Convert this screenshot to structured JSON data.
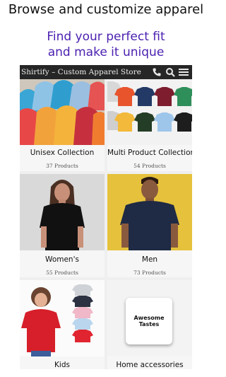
{
  "promo": {
    "heading": "Browse and customize apparel",
    "subtitle_line1": "Find your perfect fit",
    "subtitle_line2": "and make it unique"
  },
  "topbar": {
    "title": "Shirtify – Custom Apparel Store",
    "icons": [
      "phone-icon",
      "search-icon",
      "menu-icon"
    ]
  },
  "collections": [
    {
      "name": "Unisex Collection",
      "count": "37 Products"
    },
    {
      "name": "Multi Product Collection",
      "count": "54 Products"
    },
    {
      "name": "Women's",
      "count": "55 Products"
    },
    {
      "name": "Men",
      "count": "73 Products"
    },
    {
      "name": "Kids",
      "count": ""
    },
    {
      "name": "Home accessories",
      "count": ""
    }
  ],
  "home_card": {
    "line1": "Awesome",
    "line2": "Tastes"
  }
}
